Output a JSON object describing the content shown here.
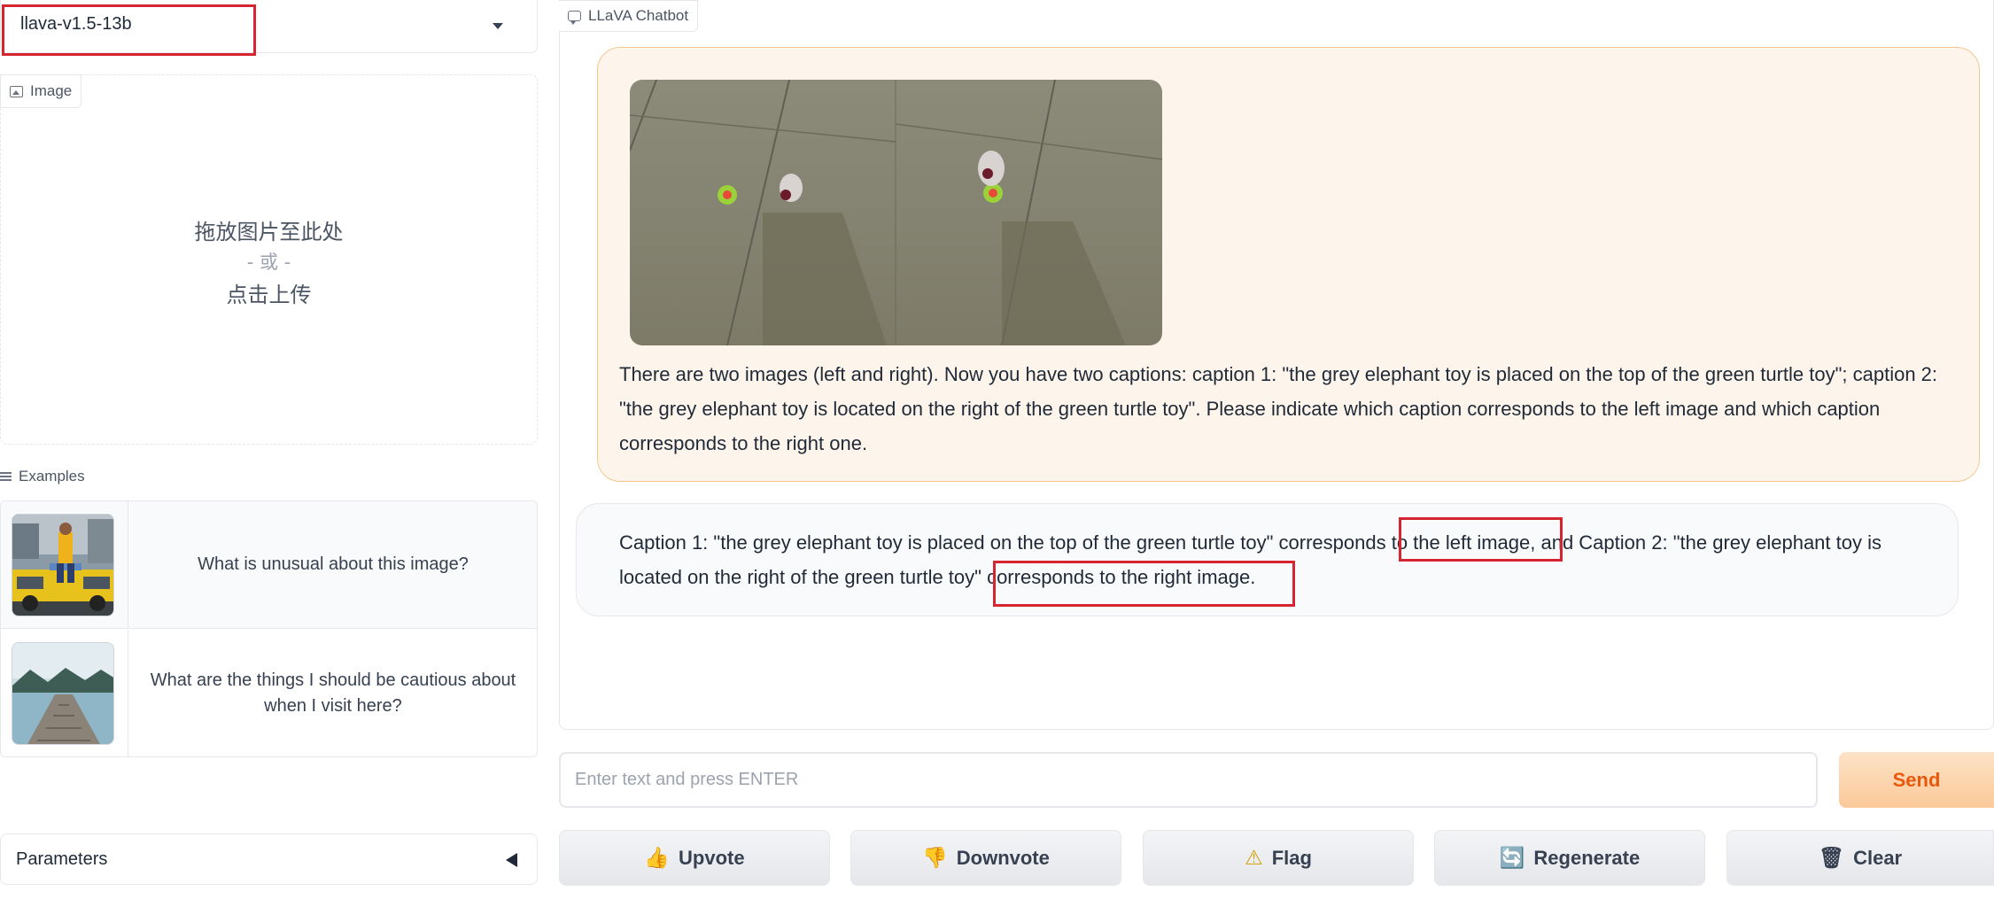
{
  "model_selector": {
    "value": "llava-v1.5-13b"
  },
  "image_upload": {
    "label": "Image",
    "drop_line1": "拖放图片至此处",
    "drop_line2": "- 或 -",
    "drop_line3": "点击上传"
  },
  "examples": {
    "label": "Examples",
    "items": [
      {
        "text": "What is unusual about this image?",
        "thumbnail": "man-ironing-on-taxi"
      },
      {
        "text": "What are the things I should be cautious about when I visit here?",
        "thumbnail": "wooden-pier-lake"
      }
    ]
  },
  "parameters": {
    "label": "Parameters"
  },
  "chatbot": {
    "label": "LLaVA Chatbot",
    "user_image": "two-toy-photos-elephant-turtle",
    "user_message": "There are two images (left and right). Now you have two captions: caption 1: \"the grey elephant toy is placed on the top of the green turtle toy\"; caption 2: \"the grey elephant toy is located on the right of the green turtle toy\". Please indicate which caption corresponds to the left image and which caption corresponds to the right one.",
    "bot_message": "Caption 1: \"the grey elephant toy is placed on the top of the green turtle toy\" corresponds to the left image, and Caption 2: \"the grey elephant toy is located on the right of the green turtle toy\" corresponds to the right image."
  },
  "input": {
    "placeholder": "Enter text and press ENTER",
    "send_label": "Send"
  },
  "buttons": {
    "upvote": "Upvote",
    "downvote": "Downvote",
    "flag": "Flag",
    "regenerate": "Regenerate",
    "clear": "Clear"
  },
  "colors": {
    "highlight_box": "#d62431",
    "user_bubble": "#fdf5eb",
    "bot_bubble": "#f9fafb",
    "send_text": "#ea580c"
  }
}
